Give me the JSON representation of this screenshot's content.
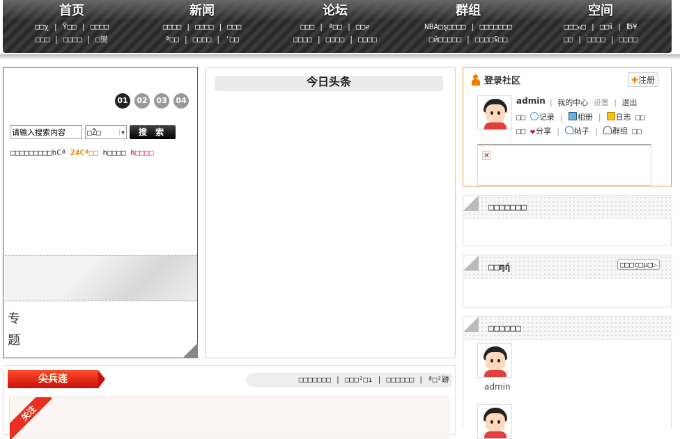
{
  "nav": [
    {
      "title": "首页",
      "line1": "□□χ | Ÿ□□ | □□□□",
      "line2": "□□□ | □□□□ | □爕"
    },
    {
      "title": "新闻",
      "line1": "□□□□ | □□□□ | □□□",
      "line2": "ª□□ | □□□□ | ˈ□□"
    },
    {
      "title": "论坛",
      "line1": "□□□ | ª□□ | □□ℯ",
      "line2": "□□□□ | □□□□ | □□□□"
    },
    {
      "title": "群组",
      "line1": "NBA□ȿ□□□□ | □□□□□□□",
      "line2": "□й□□□□□ | □□□□ʢ□□"
    },
    {
      "title": "空间",
      "line1": "□□□ℴ□ | □□ⅱ | ℔¥",
      "line2": "□□ | □□□□ | □□□□"
    }
  ],
  "left": {
    "slides": [
      "01",
      "02",
      "03",
      "04"
    ],
    "search_placeholder": "请输入搜索内容",
    "search_select": "□Ž□",
    "search_button": "搜 索",
    "weather_prefix": "□□□□□□□□□hCª ",
    "weather_temp": "24Cª□□",
    "weather_mid": " h□□□□ ",
    "weather_hi": "h□□□□",
    "topic_label": "专题"
  },
  "center": {
    "headline": "今日头条"
  },
  "login": {
    "title": "登录社区",
    "register": "注册",
    "username": "admin",
    "my_center": "我的中心",
    "settings": "设置",
    "logout": "退出",
    "row1": [
      {
        "pre": "□□ ",
        "label": "记录"
      },
      {
        "pre": "",
        "label": "相册"
      },
      {
        "pre": "",
        "label": "日志"
      },
      {
        "pre": "",
        "label": "□□"
      }
    ],
    "row2": [
      {
        "pre": "□□ ",
        "label": "分享"
      },
      {
        "pre": "",
        "label": "帖子"
      },
      {
        "pre": "",
        "label": "群组"
      },
      {
        "pre": "",
        "label": "□□"
      }
    ]
  },
  "boxes": [
    {
      "title": "□□□□□□□"
    },
    {
      "title": "□□ɱή",
      "more": "□□□ç□μ□▷"
    },
    {
      "title": "□□□□□□",
      "member_name": "admin"
    }
  ],
  "bottom": {
    "ribbon": "尖兵连",
    "links": "□□□□□□□ | □□□²□ı | □□□□□□ | ª□²跡",
    "corner": "关注"
  },
  "colors": {
    "accent": "#e59a3a",
    "nav_bg": "#2e2e2e",
    "ribbon": "#d8180d"
  }
}
